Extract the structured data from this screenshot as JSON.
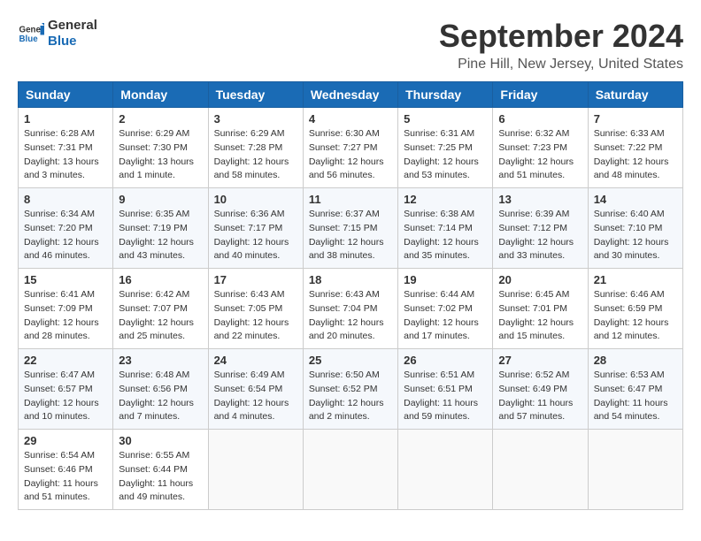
{
  "header": {
    "logo_line1": "General",
    "logo_line2": "Blue",
    "month": "September 2024",
    "location": "Pine Hill, New Jersey, United States"
  },
  "weekdays": [
    "Sunday",
    "Monday",
    "Tuesday",
    "Wednesday",
    "Thursday",
    "Friday",
    "Saturday"
  ],
  "weeks": [
    [
      {
        "day": "1",
        "info": "Sunrise: 6:28 AM\nSunset: 7:31 PM\nDaylight: 13 hours\nand 3 minutes."
      },
      {
        "day": "2",
        "info": "Sunrise: 6:29 AM\nSunset: 7:30 PM\nDaylight: 13 hours\nand 1 minute."
      },
      {
        "day": "3",
        "info": "Sunrise: 6:29 AM\nSunset: 7:28 PM\nDaylight: 12 hours\nand 58 minutes."
      },
      {
        "day": "4",
        "info": "Sunrise: 6:30 AM\nSunset: 7:27 PM\nDaylight: 12 hours\nand 56 minutes."
      },
      {
        "day": "5",
        "info": "Sunrise: 6:31 AM\nSunset: 7:25 PM\nDaylight: 12 hours\nand 53 minutes."
      },
      {
        "day": "6",
        "info": "Sunrise: 6:32 AM\nSunset: 7:23 PM\nDaylight: 12 hours\nand 51 minutes."
      },
      {
        "day": "7",
        "info": "Sunrise: 6:33 AM\nSunset: 7:22 PM\nDaylight: 12 hours\nand 48 minutes."
      }
    ],
    [
      {
        "day": "8",
        "info": "Sunrise: 6:34 AM\nSunset: 7:20 PM\nDaylight: 12 hours\nand 46 minutes."
      },
      {
        "day": "9",
        "info": "Sunrise: 6:35 AM\nSunset: 7:19 PM\nDaylight: 12 hours\nand 43 minutes."
      },
      {
        "day": "10",
        "info": "Sunrise: 6:36 AM\nSunset: 7:17 PM\nDaylight: 12 hours\nand 40 minutes."
      },
      {
        "day": "11",
        "info": "Sunrise: 6:37 AM\nSunset: 7:15 PM\nDaylight: 12 hours\nand 38 minutes."
      },
      {
        "day": "12",
        "info": "Sunrise: 6:38 AM\nSunset: 7:14 PM\nDaylight: 12 hours\nand 35 minutes."
      },
      {
        "day": "13",
        "info": "Sunrise: 6:39 AM\nSunset: 7:12 PM\nDaylight: 12 hours\nand 33 minutes."
      },
      {
        "day": "14",
        "info": "Sunrise: 6:40 AM\nSunset: 7:10 PM\nDaylight: 12 hours\nand 30 minutes."
      }
    ],
    [
      {
        "day": "15",
        "info": "Sunrise: 6:41 AM\nSunset: 7:09 PM\nDaylight: 12 hours\nand 28 minutes."
      },
      {
        "day": "16",
        "info": "Sunrise: 6:42 AM\nSunset: 7:07 PM\nDaylight: 12 hours\nand 25 minutes."
      },
      {
        "day": "17",
        "info": "Sunrise: 6:43 AM\nSunset: 7:05 PM\nDaylight: 12 hours\nand 22 minutes."
      },
      {
        "day": "18",
        "info": "Sunrise: 6:43 AM\nSunset: 7:04 PM\nDaylight: 12 hours\nand 20 minutes."
      },
      {
        "day": "19",
        "info": "Sunrise: 6:44 AM\nSunset: 7:02 PM\nDaylight: 12 hours\nand 17 minutes."
      },
      {
        "day": "20",
        "info": "Sunrise: 6:45 AM\nSunset: 7:01 PM\nDaylight: 12 hours\nand 15 minutes."
      },
      {
        "day": "21",
        "info": "Sunrise: 6:46 AM\nSunset: 6:59 PM\nDaylight: 12 hours\nand 12 minutes."
      }
    ],
    [
      {
        "day": "22",
        "info": "Sunrise: 6:47 AM\nSunset: 6:57 PM\nDaylight: 12 hours\nand 10 minutes."
      },
      {
        "day": "23",
        "info": "Sunrise: 6:48 AM\nSunset: 6:56 PM\nDaylight: 12 hours\nand 7 minutes."
      },
      {
        "day": "24",
        "info": "Sunrise: 6:49 AM\nSunset: 6:54 PM\nDaylight: 12 hours\nand 4 minutes."
      },
      {
        "day": "25",
        "info": "Sunrise: 6:50 AM\nSunset: 6:52 PM\nDaylight: 12 hours\nand 2 minutes."
      },
      {
        "day": "26",
        "info": "Sunrise: 6:51 AM\nSunset: 6:51 PM\nDaylight: 11 hours\nand 59 minutes."
      },
      {
        "day": "27",
        "info": "Sunrise: 6:52 AM\nSunset: 6:49 PM\nDaylight: 11 hours\nand 57 minutes."
      },
      {
        "day": "28",
        "info": "Sunrise: 6:53 AM\nSunset: 6:47 PM\nDaylight: 11 hours\nand 54 minutes."
      }
    ],
    [
      {
        "day": "29",
        "info": "Sunrise: 6:54 AM\nSunset: 6:46 PM\nDaylight: 11 hours\nand 51 minutes."
      },
      {
        "day": "30",
        "info": "Sunrise: 6:55 AM\nSunset: 6:44 PM\nDaylight: 11 hours\nand 49 minutes."
      },
      {
        "day": "",
        "info": ""
      },
      {
        "day": "",
        "info": ""
      },
      {
        "day": "",
        "info": ""
      },
      {
        "day": "",
        "info": ""
      },
      {
        "day": "",
        "info": ""
      }
    ]
  ]
}
